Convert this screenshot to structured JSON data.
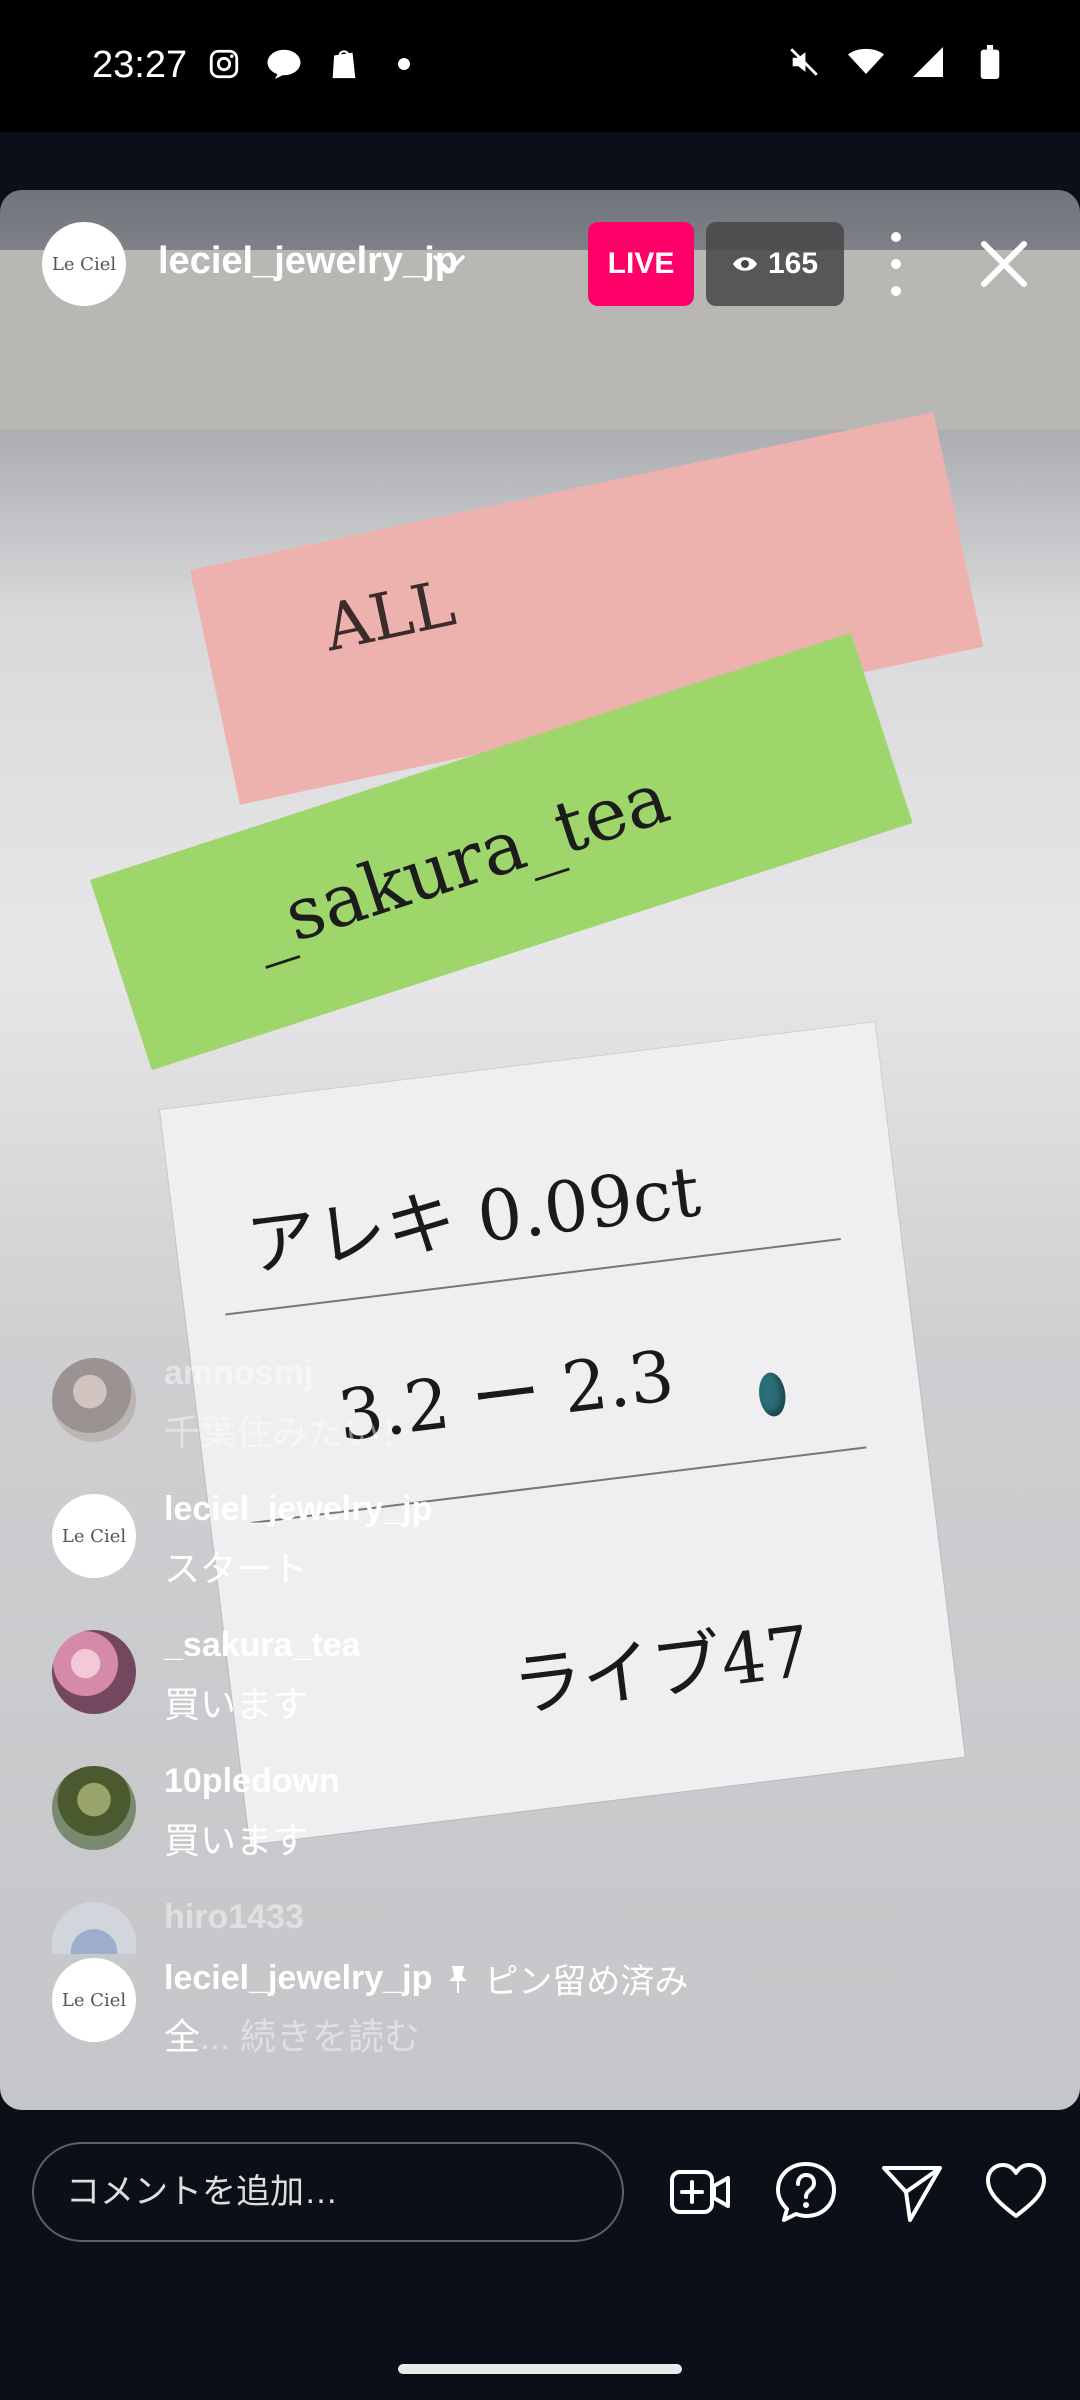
{
  "status_bar": {
    "time": "23:27",
    "left_icons": [
      "instagram-icon",
      "line-icon",
      "shopify-icon",
      "dot-icon"
    ],
    "right_icons": [
      "mute-icon",
      "wifi-icon",
      "signal-icon",
      "battery-icon"
    ]
  },
  "live": {
    "account_name": "leciel_jewelry_jp",
    "logo_text": "Le Ciel",
    "live_label": "LIVE",
    "viewer_count": "165"
  },
  "scene": {
    "pink_note": "ALL",
    "green_note": "_sakura_tea",
    "card_line1": "アレキ 0.09ct",
    "card_line2": "3.2 ー 2.3",
    "card_line3": "ライブ47"
  },
  "comments": [
    {
      "user": "amnosmj",
      "text": "千葉住みたい！",
      "faded": true
    },
    {
      "user": "leciel_jewelry_jp",
      "text": "スタート"
    },
    {
      "user": "_sakura_tea",
      "text": "買います"
    },
    {
      "user": "10pledown",
      "text": "買います"
    },
    {
      "user": "hiro1433",
      "text": ""
    }
  ],
  "pinned_comment": {
    "user": "leciel_jewelry_jp",
    "pin_label": "ピン留め済み",
    "text": "全",
    "read_more": "... 続きを読む"
  },
  "bottom_bar": {
    "comment_placeholder": "コメントを追加…",
    "icons": [
      "add-video-icon",
      "question-icon",
      "share-icon",
      "heart-icon"
    ]
  }
}
